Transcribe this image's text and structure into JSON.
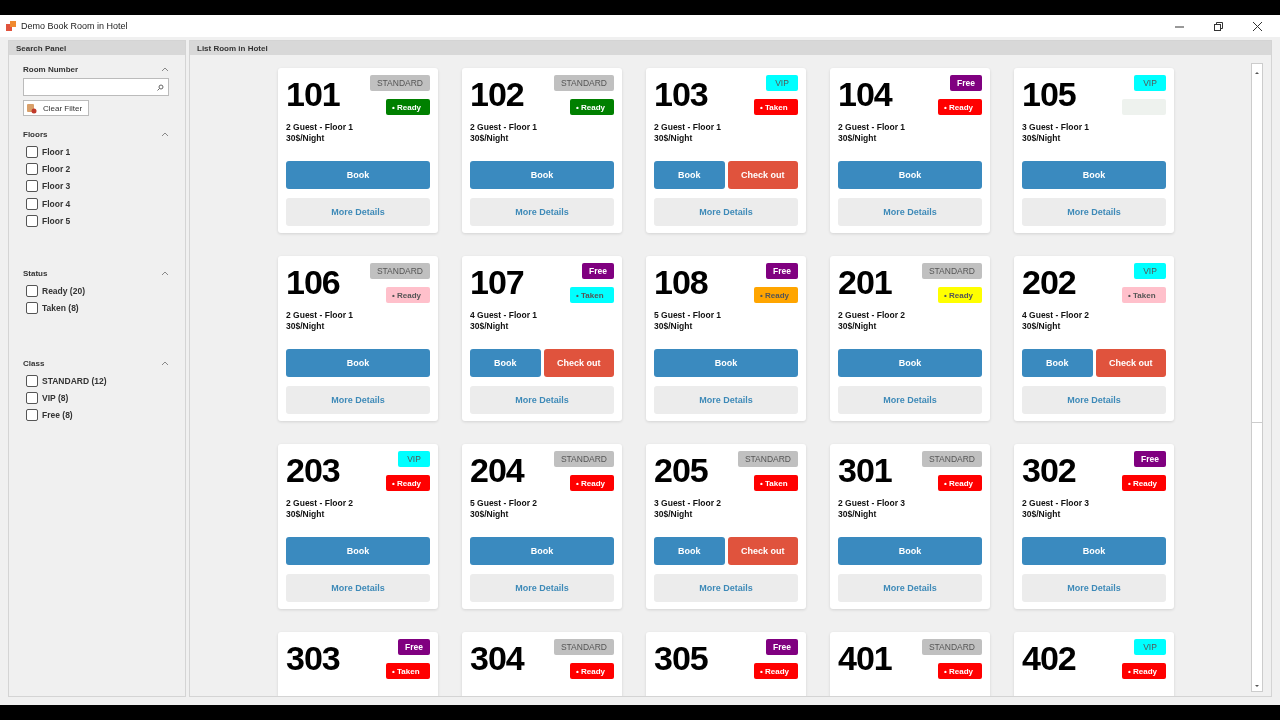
{
  "window": {
    "title": "Demo Book Room in Hotel"
  },
  "search_panel": {
    "title": "Search Panel",
    "room_number": {
      "title": "Room Number",
      "expanded": true,
      "clear_button": "Clear Filter"
    },
    "groups": [
      {
        "title": "Floors",
        "expanded": true,
        "options": [
          {
            "label": "Floor 1",
            "checked": false
          },
          {
            "label": "Floor 2",
            "checked": false
          },
          {
            "label": "Floor 3",
            "checked": false
          },
          {
            "label": "Floor 4",
            "checked": false
          },
          {
            "label": "Floor 5",
            "checked": false
          }
        ]
      },
      {
        "title": "Status",
        "expanded": true,
        "options": [
          {
            "label": "Ready (20)",
            "checked": false
          },
          {
            "label": "Taken (8)",
            "checked": false
          }
        ]
      },
      {
        "title": "Class",
        "expanded": true,
        "options": [
          {
            "label": "STANDARD (12)",
            "checked": false
          },
          {
            "label": "VIP (8)",
            "checked": false
          },
          {
            "label": "Free (8)",
            "checked": false
          }
        ]
      }
    ]
  },
  "room_list": {
    "title": "List Room in Hotel",
    "rooms": [
      {
        "number": "101",
        "class": {
          "label": "STANDARD",
          "color": "#c0c0c0"
        },
        "status": {
          "label": "• Ready",
          "color": "#008000"
        },
        "info": "2 Guest - Floor 1",
        "price": "30$/Night",
        "book": "Book",
        "details": "More Details"
      },
      {
        "number": "102",
        "class": {
          "label": "STANDARD",
          "color": "#c0c0c0"
        },
        "status": {
          "label": "• Ready",
          "color": "#008000"
        },
        "info": "2 Guest - Floor 1",
        "price": "30$/Night",
        "book": "Book",
        "details": "More Details"
      },
      {
        "number": "103",
        "class": {
          "label": "VIP",
          "color": "#00ffff"
        },
        "status": {
          "label": "• Taken",
          "color": "#ff0000"
        },
        "info": "2 Guest - Floor 1",
        "price": "30$/Night",
        "book": "Book",
        "checkout": "Check out",
        "details": "More Details"
      },
      {
        "number": "104",
        "class": {
          "label": "Free",
          "color": "#800080"
        },
        "status": {
          "label": "• Ready",
          "color": "#ff0000"
        },
        "info": "2 Guest - Floor 1",
        "price": "30$/Night",
        "book": "Book",
        "details": "More Details"
      },
      {
        "number": "105",
        "class": {
          "label": "VIP",
          "color": "#00ffff"
        },
        "status": {
          "color": "#eef2ee"
        },
        "info": "3 Guest - Floor 1",
        "price": "30$/Night",
        "book": "Book",
        "details": "More Details"
      },
      {
        "number": "106",
        "class": {
          "label": "STANDARD",
          "color": "#c0c0c0"
        },
        "status": {
          "label": "• Ready",
          "color": "#ffc0cb"
        },
        "info": "2 Guest - Floor 1",
        "price": "30$/Night",
        "book": "Book",
        "details": "More Details"
      },
      {
        "number": "107",
        "class": {
          "label": "Free",
          "color": "#800080"
        },
        "status": {
          "label": "• Taken",
          "color": "#00ffff"
        },
        "info": "4 Guest - Floor 1",
        "price": "30$/Night",
        "book": "Book",
        "checkout": "Check out",
        "details": "More Details"
      },
      {
        "number": "108",
        "class": {
          "label": "Free",
          "color": "#800080"
        },
        "status": {
          "label": "• Ready",
          "color": "#ffa500"
        },
        "info": "5 Guest - Floor 1",
        "price": "30$/Night",
        "book": "Book",
        "details": "More Details"
      },
      {
        "number": "201",
        "class": {
          "label": "STANDARD",
          "color": "#c0c0c0"
        },
        "status": {
          "label": "• Ready",
          "color": "#ffff00"
        },
        "info": "2 Guest - Floor 2",
        "price": "30$/Night",
        "book": "Book",
        "details": "More Details"
      },
      {
        "number": "202",
        "class": {
          "label": "VIP",
          "color": "#00ffff"
        },
        "status": {
          "label": "• Taken",
          "color": "#ffc0cb"
        },
        "info": "4 Guest - Floor 2",
        "price": "30$/Night",
        "book": "Book",
        "checkout": "Check out",
        "details": "More Details"
      },
      {
        "number": "203",
        "class": {
          "label": "VIP",
          "color": "#00ffff"
        },
        "status": {
          "label": "• Ready",
          "color": "#ff0000"
        },
        "info": "2 Guest - Floor 2",
        "price": "30$/Night",
        "book": "Book",
        "details": "More Details"
      },
      {
        "number": "204",
        "class": {
          "label": "STANDARD",
          "color": "#c0c0c0"
        },
        "status": {
          "label": "• Ready",
          "color": "#ff0000"
        },
        "info": "5 Guest - Floor 2",
        "price": "30$/Night",
        "book": "Book",
        "details": "More Details"
      },
      {
        "number": "205",
        "class": {
          "label": "STANDARD",
          "color": "#c0c0c0"
        },
        "status": {
          "label": "• Taken",
          "color": "#ff0000"
        },
        "info": "3 Guest - Floor 2",
        "price": "30$/Night",
        "book": "Book",
        "checkout": "Check out",
        "details": "More Details"
      },
      {
        "number": "301",
        "class": {
          "label": "STANDARD",
          "color": "#c0c0c0"
        },
        "status": {
          "label": "• Ready",
          "color": "#ff0000"
        },
        "info": "2 Guest - Floor 3",
        "price": "30$/Night",
        "book": "Book",
        "details": "More Details"
      },
      {
        "number": "302",
        "class": {
          "label": "Free",
          "color": "#800080"
        },
        "status": {
          "label": "• Ready",
          "color": "#ff0000"
        },
        "info": "2 Guest - Floor 3",
        "price": "30$/Night",
        "book": "Book",
        "details": "More Details"
      },
      {
        "number": "303",
        "class": {
          "label": "Free",
          "color": "#800080"
        },
        "status": {
          "label": "• Taken",
          "color": "#ff0000"
        }
      },
      {
        "number": "304",
        "class": {
          "label": "STANDARD",
          "color": "#c0c0c0"
        },
        "status": {
          "label": "• Ready",
          "color": "#ff0000"
        }
      },
      {
        "number": "305",
        "class": {
          "label": "Free",
          "color": "#800080"
        },
        "status": {
          "label": "• Ready",
          "color": "#ff0000"
        }
      },
      {
        "number": "401",
        "class": {
          "label": "STANDARD",
          "color": "#c0c0c0"
        },
        "status": {
          "label": "• Ready",
          "color": "#ff0000"
        }
      },
      {
        "number": "402",
        "class": {
          "label": "VIP",
          "color": "#00ffff"
        },
        "status": {
          "label": "• Ready",
          "color": "#ff0000"
        }
      }
    ]
  }
}
